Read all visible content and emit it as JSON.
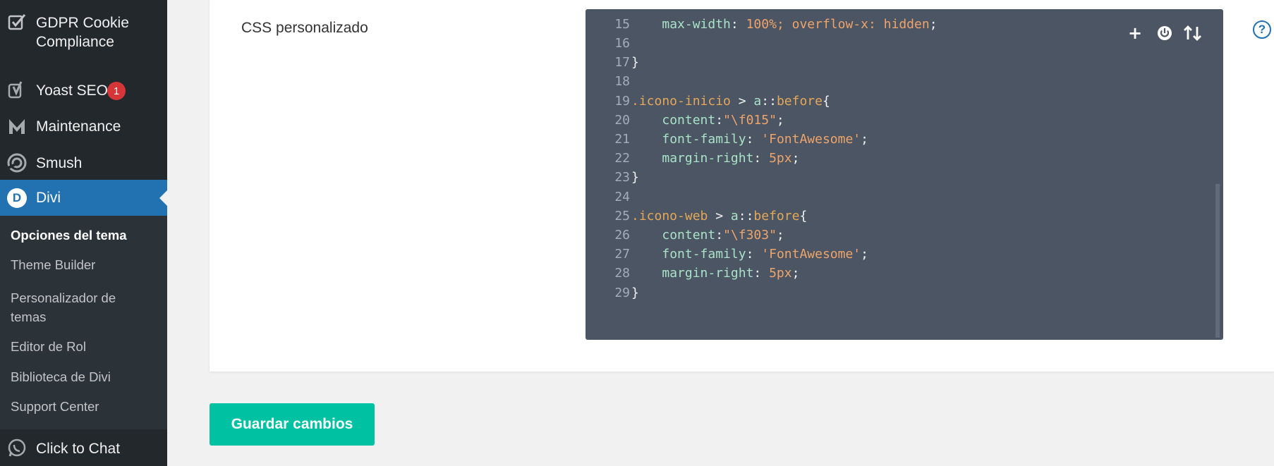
{
  "sidebar": {
    "items": {
      "gdpr": {
        "label": "GDPR Cookie Compliance",
        "icon": "checkbox-icon"
      },
      "yoast": {
        "label": "Yoast SEO",
        "badge": "1",
        "icon": "yoast-icon"
      },
      "maintenance": {
        "label": "Maintenance",
        "icon": "maintenance-m-icon"
      },
      "smush": {
        "label": "Smush",
        "icon": "smush-icon"
      },
      "divi": {
        "label": "Divi",
        "icon_letter": "D"
      },
      "chat": {
        "label": "Click to Chat",
        "icon": "whatsapp-icon"
      }
    },
    "submenu": [
      "Opciones del tema",
      "Theme Builder",
      "Personalizador de temas",
      "Editor de Rol",
      "Biblioteca de Divi",
      "Support Center"
    ]
  },
  "main": {
    "css_label": "CSS personalizado",
    "help_symbol": "?",
    "save_label": "Guardar cambios",
    "editor": {
      "toolbar": {
        "plus": "+",
        "power": "⏻",
        "sort": "⇅"
      },
      "lines": [
        {
          "n": "15",
          "text": "    max-width: 100%; overflow-x: hidden;"
        },
        {
          "n": "16",
          "text": ""
        },
        {
          "n": "17",
          "text": "}"
        },
        {
          "n": "18",
          "text": ""
        },
        {
          "n": "19",
          "text": ".icono-inicio > a::before{"
        },
        {
          "n": "20",
          "text": "    content:\"\\f015\";"
        },
        {
          "n": "21",
          "text": "    font-family: 'FontAwesome';"
        },
        {
          "n": "22",
          "text": "    margin-right: 5px;"
        },
        {
          "n": "23",
          "text": "}"
        },
        {
          "n": "24",
          "text": ""
        },
        {
          "n": "25",
          "text": ".icono-web > a::before{"
        },
        {
          "n": "26",
          "text": "    content:\"\\f303\";"
        },
        {
          "n": "27",
          "text": "    font-family: 'FontAwesome';"
        },
        {
          "n": "28",
          "text": "    margin-right: 5px;"
        },
        {
          "n": "29",
          "text": "}"
        }
      ]
    }
  },
  "colors": {
    "sidebar_bg": "#23282d",
    "active_menu": "#2271b1",
    "editor_bg": "#4b5563",
    "save_button": "#00c2a2",
    "badge": "#d63638"
  }
}
